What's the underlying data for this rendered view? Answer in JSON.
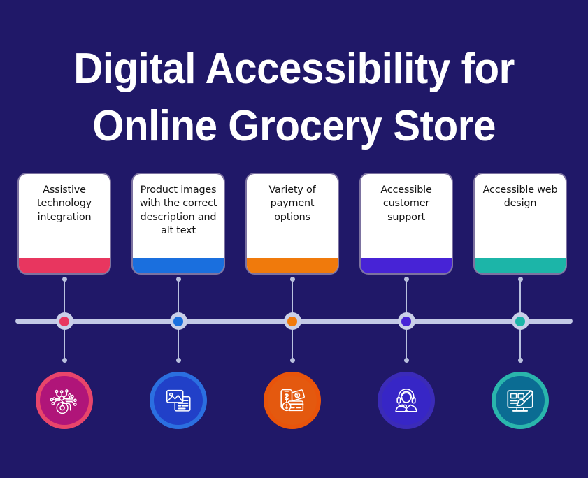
{
  "page": {
    "background_color": "#201868",
    "title_lines": [
      "Digital Accessibility for",
      "Online Grocery Store"
    ],
    "title_color": "#ffffff"
  },
  "timeline": {
    "line_color": "#c3c9e6",
    "node_ring_color": "#c9cfe8",
    "connector_color": "#b9c0de"
  },
  "steps": [
    {
      "index": 1,
      "card_text": "Assistive technology integration",
      "accent_color": "#E8365F",
      "node_color": "#E8365F",
      "icon_ring_color": "#E8456B",
      "icon_core_color": "#B01579",
      "icon_name": "assistive-technology-icon"
    },
    {
      "index": 2,
      "card_text": "Product images with the correct description and alt text",
      "accent_color": "#1A6FDE",
      "node_color": "#1A6FDE",
      "icon_ring_color": "#2B6FE0",
      "icon_core_color": "#2140C8",
      "icon_name": "image-with-alt-text-icon"
    },
    {
      "index": 3,
      "card_text": "Variety of payment options",
      "accent_color": "#F07A0C",
      "node_color": "#F07A0C",
      "icon_ring_color": "#E8540B",
      "icon_core_color": "#E4590F",
      "icon_name": "payment-options-icon"
    },
    {
      "index": 4,
      "card_text": "Accessible customer support",
      "accent_color": "#4723D6",
      "node_color": "#4723D6",
      "icon_ring_color": "#3B2BB8",
      "icon_core_color": "#3726C6",
      "icon_name": "customer-support-headset-icon"
    },
    {
      "index": 5,
      "card_text": "Accessible web design",
      "accent_color": "#1CB5A8",
      "node_color": "#1CB5A8",
      "icon_ring_color": "#2AB5AC",
      "icon_core_color": "#0B6C93",
      "icon_name": "web-design-monitor-brush-icon"
    }
  ]
}
